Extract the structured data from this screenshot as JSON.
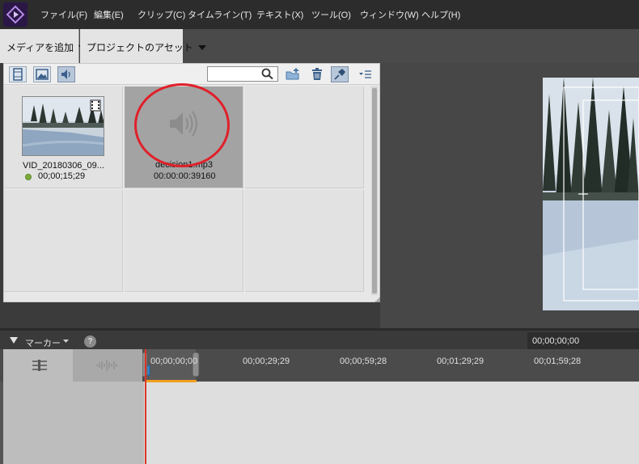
{
  "menu": {
    "items": [
      "ファイル(F)",
      "編集(E)",
      "クリップ(C)",
      "タイムライン(T)",
      "テキスト(X)",
      "ツール(O)",
      "ウィンドウ(W)",
      "ヘルプ(H)"
    ]
  },
  "toolbar": {
    "add_media": "メディアを追加",
    "project_assets": "プロジェクトのアセット"
  },
  "assets": {
    "search_placeholder": "",
    "clips": [
      {
        "name": "VID_20180306_09...",
        "duration": "00;00;15;29",
        "type": "video",
        "status_color": "#7cab3c"
      },
      {
        "name": "decision1.mp3",
        "duration": "00:00:00:39160",
        "type": "audio",
        "selected": true,
        "highlighted": true
      }
    ]
  },
  "timeline": {
    "marker_label": "マーカー",
    "current_timecode": "00;00;00;00",
    "ruler": [
      "00;00;00;00",
      "00;00;29;29",
      "00;00;59;28",
      "00;01;29;29",
      "00;01;59;28"
    ]
  },
  "colors": {
    "highlight_circle": "#e0202a",
    "playhead": "#d9362a",
    "app_logo": "#2a1746"
  }
}
